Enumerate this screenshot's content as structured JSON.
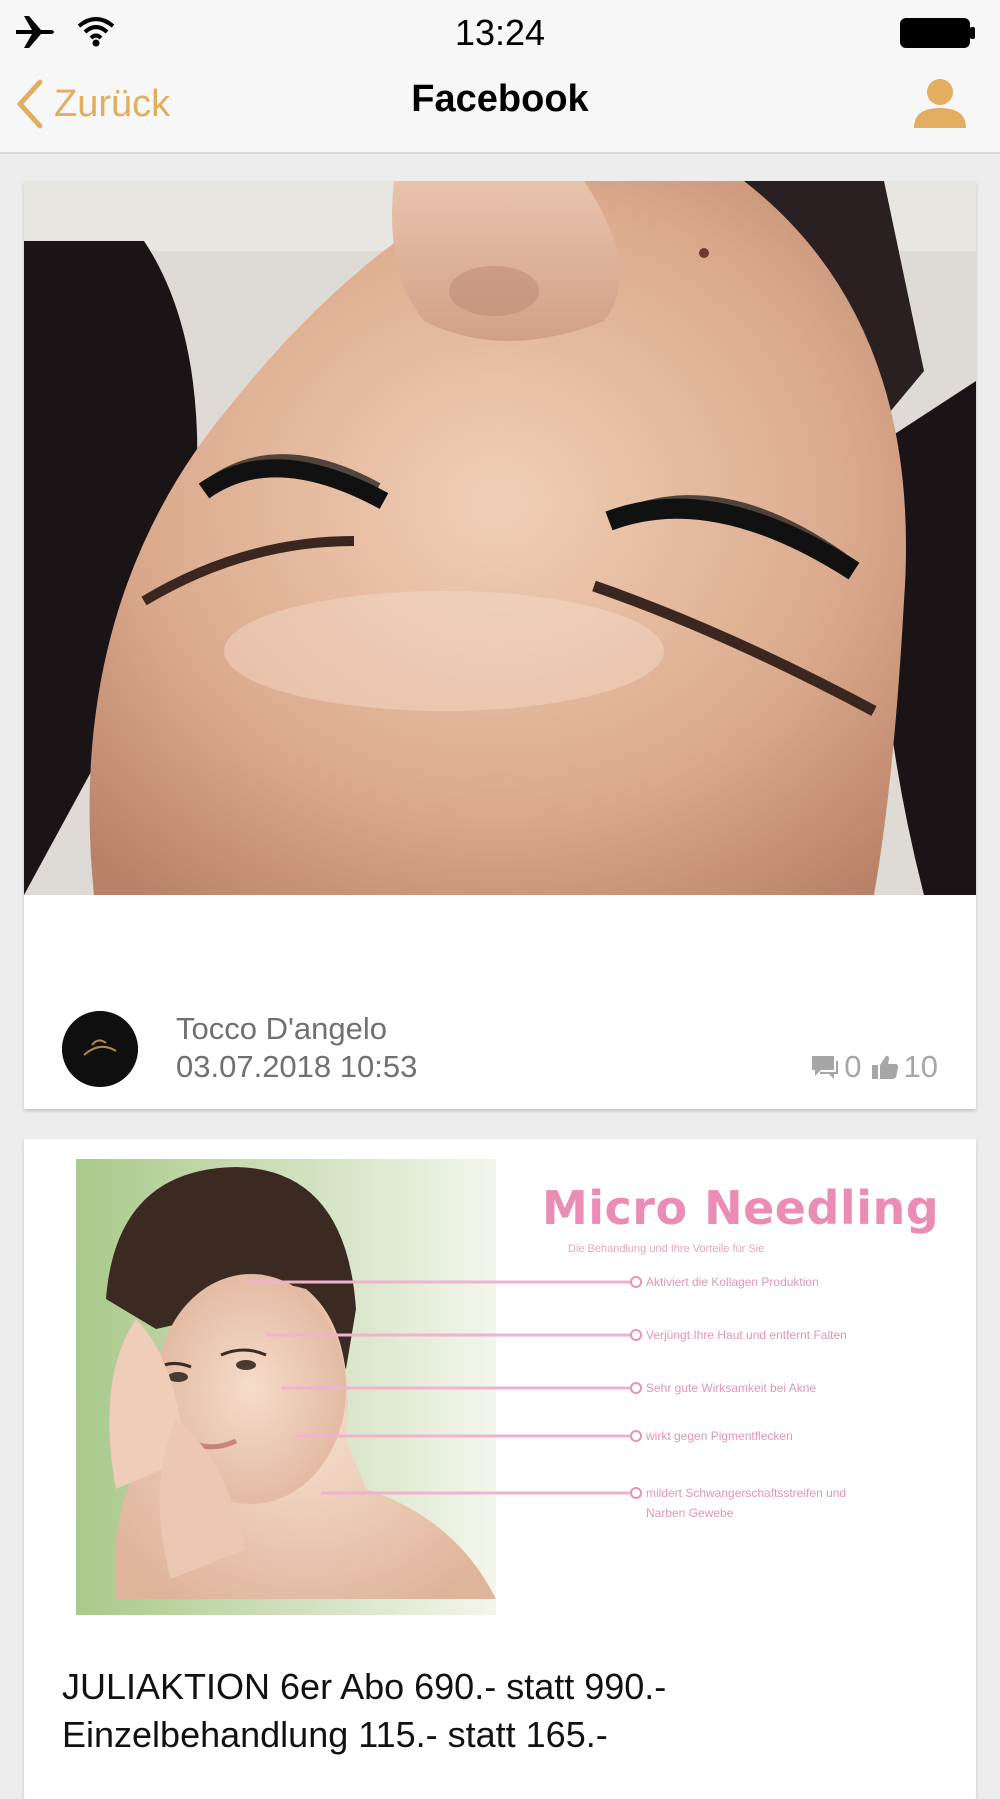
{
  "status_bar": {
    "time": "13:24",
    "icons": [
      "airplane-icon",
      "wifi-icon",
      "battery-icon"
    ]
  },
  "nav": {
    "back_label": "Zurück",
    "title": "Facebook",
    "profile_icon": "person-icon"
  },
  "colors": {
    "accent": "#e2ad60",
    "promo_pink": "#eb8cb4"
  },
  "posts": [
    {
      "author": "Tocco D'angelo",
      "date": "03.07.2018 10:53",
      "comments": "0",
      "likes": "10"
    },
    {
      "promo": {
        "title": "Micro Needling",
        "subtitle": "Die Behandlung und Ihre Vorteile für Sie",
        "benefits": [
          "Aktiviert die Kollagen Produktion",
          "Verjüngt Ihre Haut und entfernt Falten",
          "Sehr gute Wirksamkeit bei Akne",
          "wirkt gegen  Pigmentflecken",
          "mildert Schwangerschaftsstreifen und",
          "Narben Gewebe"
        ]
      },
      "text_line1": "JULIAKTION 6er Abo 690.- statt 990.-",
      "text_line2": "Einzelbehandlung 115.- statt 165.-"
    }
  ]
}
